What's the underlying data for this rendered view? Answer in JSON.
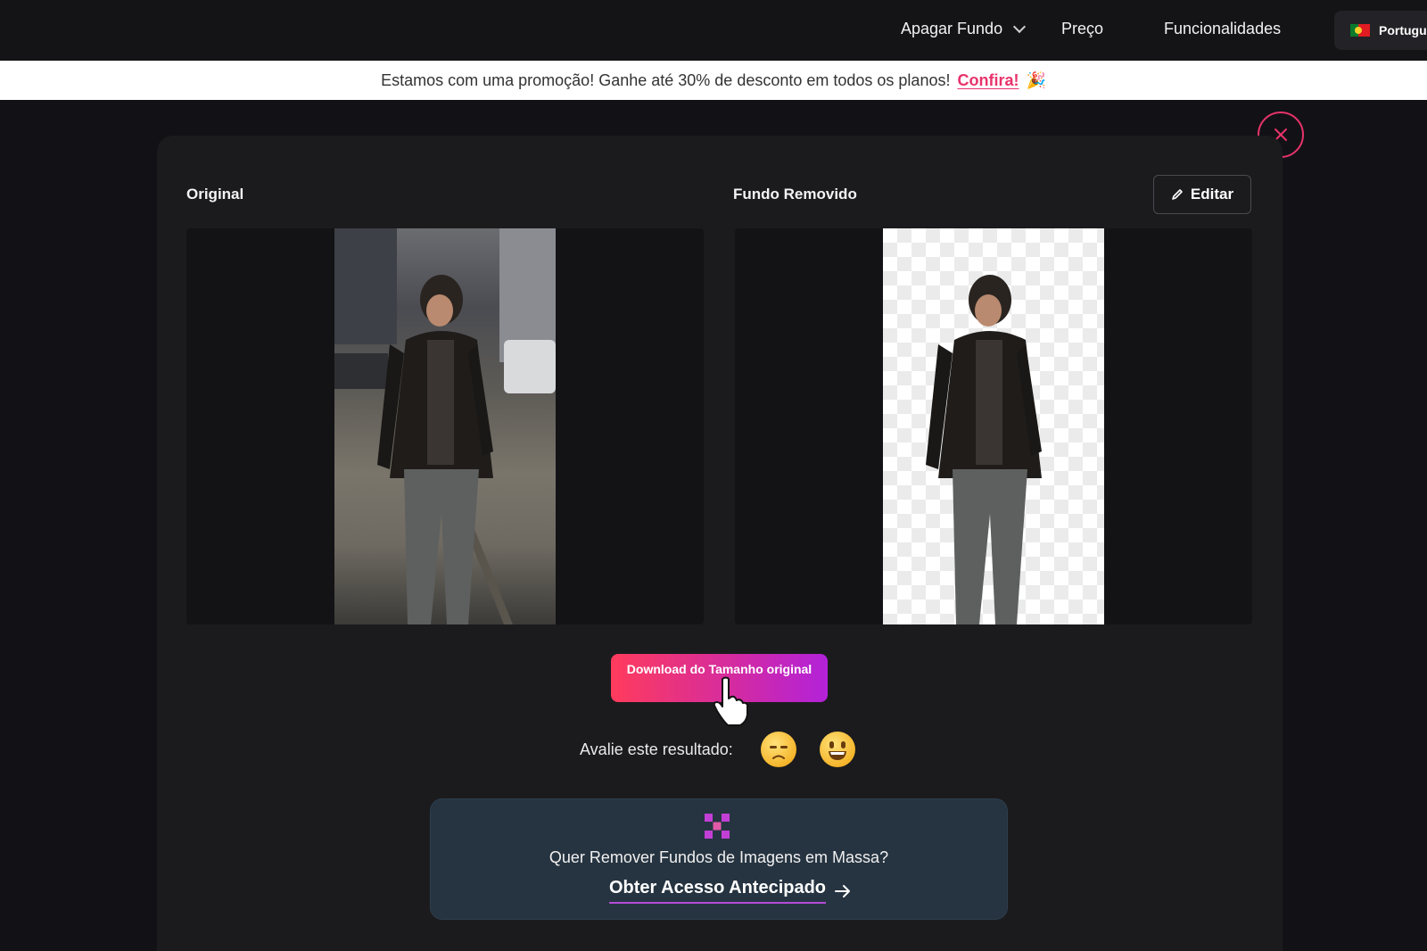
{
  "nav": {
    "remove_bg": "Apagar Fundo",
    "pricing": "Preço",
    "features": "Funcionalidades",
    "language": "Português"
  },
  "promo": {
    "text": "Estamos com uma promoção! Ganhe até 30% de desconto em todos os planos!",
    "link": "Confira!"
  },
  "result": {
    "original_title": "Original",
    "removed_title": "Fundo Removido",
    "edit_label": "Editar",
    "close_icon": "close-icon",
    "download_label": "Download do Tamanho original"
  },
  "rating": {
    "label": "Avalie este resultado:",
    "options": [
      "sad-emoji-icon",
      "grin-emoji-icon"
    ]
  },
  "bulk": {
    "question": "Quer Remover Fundos de Imagens em Massa?",
    "cta": "Obter Acesso Antecipado"
  },
  "colors": {
    "accent": "#e8336b",
    "gradient_start": "#ff3b5c",
    "gradient_end": "#b222d9"
  }
}
